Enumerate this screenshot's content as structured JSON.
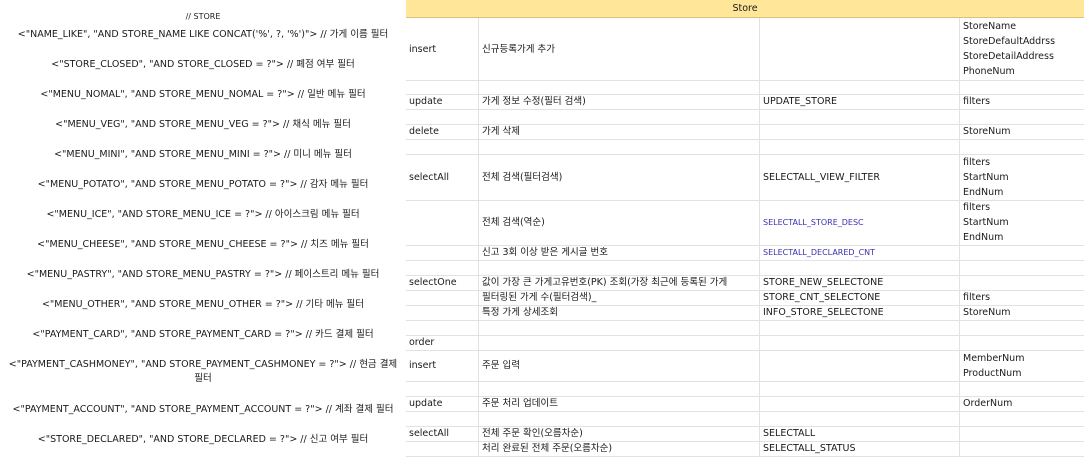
{
  "left_filters": [
    {
      "id": "store",
      "text": "// STORE"
    },
    {
      "id": "name_like",
      "text": "<\"NAME_LIKE\", \"AND STORE_NAME LIKE CONCAT('%', ?, '%')\"> // 가게 이름 필터"
    },
    {
      "id": "store_closed",
      "text": "<\"STORE_CLOSED\", \"AND STORE_CLOSED = ?\"> // 폐점 여부 필터"
    },
    {
      "id": "menu_nomal",
      "text": "<\"MENU_NOMAL\", \"AND STORE_MENU_NOMAL = ?\"> // 일반 메뉴 필터"
    },
    {
      "id": "menu_veg",
      "text": "<\"MENU_VEG\", \"AND STORE_MENU_VEG = ?\"> // 채식 메뉴 필터"
    },
    {
      "id": "menu_mini",
      "text": "<\"MENU_MINI\", \"AND STORE_MENU_MINI = ?\"> // 미니 메뉴 필터"
    },
    {
      "id": "menu_potato",
      "text": "<\"MENU_POTATO\", \"AND STORE_MENU_POTATO = ?\"> // 감자 메뉴 필터"
    },
    {
      "id": "menu_ice",
      "text": "<\"MENU_ICE\", \"AND STORE_MENU_ICE = ?\"> // 아이스크림 메뉴 필터"
    },
    {
      "id": "menu_cheese",
      "text": "<\"MENU_CHEESE\", \"AND STORE_MENU_CHEESE = ?\"> // 치즈 메뉴 필터"
    },
    {
      "id": "menu_pastry",
      "text": "<\"MENU_PASTRY\", \"AND STORE_MENU_PASTRY = ?\"> // 페이스트리 메뉴 필터"
    },
    {
      "id": "menu_other",
      "text": "<\"MENU_OTHER\", \"AND STORE_MENU_OTHER = ?\"> // 기타 메뉴 필터"
    },
    {
      "id": "payment_card",
      "text": "<\"PAYMENT_CARD\", \"AND STORE_PAYMENT_CARD = ?\"> // 카드 결제 필터"
    },
    {
      "id": "payment_cashmoney",
      "text": "<\"PAYMENT_CASHMONEY\", \"AND STORE_PAYMENT_CASHMONEY = ?\"> // 현금 결제 필터"
    },
    {
      "id": "payment_account",
      "text": "<\"PAYMENT_ACCOUNT\", \"AND STORE_PAYMENT_ACCOUNT = ?\"> // 계좌 결제 필터"
    },
    {
      "id": "store_declared",
      "text": "<\"STORE_DECLARED\", \"AND STORE_DECLARED = ?\"> // 신고 여부 필터"
    }
  ],
  "sheet": {
    "header": "Store",
    "rows": [
      {
        "op": "insert",
        "desc": "신규등록가게 추가",
        "query": "",
        "params": [
          "StoreName",
          "StoreDefaultAddrss",
          "StoreDetailAddress",
          "PhoneNum"
        ]
      },
      {
        "op": "",
        "desc": "",
        "query": "",
        "params": []
      },
      {
        "op": "update",
        "desc": "가게 정보 수정(필터 검색)",
        "query": "UPDATE_STORE",
        "params": [
          "filters"
        ]
      },
      {
        "op": "",
        "desc": "",
        "query": "",
        "params": []
      },
      {
        "op": "delete",
        "desc": "가게 삭제",
        "query": "",
        "params": [
          "StoreNum"
        ]
      },
      {
        "op": "",
        "desc": "",
        "query": "",
        "params": []
      },
      {
        "op": "selectAll",
        "desc": "전체 검색(필터검색)",
        "query": "SELECTALL_VIEW_FILTER",
        "params": [
          "filters",
          "StartNum",
          "EndNum"
        ]
      },
      {
        "op": "",
        "desc": "전체 검색(역순)",
        "query": "SELECTALL_STORE_DESC",
        "params": [
          "filters",
          "StartNum",
          "EndNum"
        ]
      },
      {
        "op": "",
        "desc": "신고 3회 이상 받은 게시글 번호",
        "query": "SELECTALL_DECLARED_CNT",
        "params": []
      },
      {
        "op": "",
        "desc": "",
        "query": "",
        "params": []
      },
      {
        "op": "selectOne",
        "desc": "값이 가장 큰 가게고유번호(PK) 조회(가장 최근에 등록된 가게",
        "query": "STORE_NEW_SELECTONE",
        "params": []
      },
      {
        "op": "",
        "desc": "필터링된 가게 수(필터검색)_",
        "query": "STORE_CNT_SELECTONE",
        "params": [
          "filters"
        ]
      },
      {
        "op": "",
        "desc": "특정 가게 상세조회",
        "query": "INFO_STORE_SELECTONE",
        "params": [
          "StoreNum"
        ]
      },
      {
        "op": "",
        "desc": "",
        "query": "",
        "params": []
      },
      {
        "op": "order",
        "desc": "",
        "query": "",
        "params": []
      },
      {
        "op": "insert",
        "desc": "주문 입력",
        "query": "",
        "params": [
          "MemberNum",
          "ProductNum"
        ]
      },
      {
        "op": "",
        "desc": "",
        "query": "",
        "params": []
      },
      {
        "op": "update",
        "desc": "주문 처리 업데이트",
        "query": "",
        "params": [
          "OrderNum"
        ]
      },
      {
        "op": "",
        "desc": "",
        "query": "",
        "params": []
      },
      {
        "op": "selectAll",
        "desc": "전체 주문 확인(오름차순)",
        "query": "SELECTALL",
        "params": []
      },
      {
        "op": "",
        "desc": "처리 완료된 전체 주문(오름차순)",
        "query": "SELECTALL_STATUS",
        "params": []
      }
    ]
  }
}
